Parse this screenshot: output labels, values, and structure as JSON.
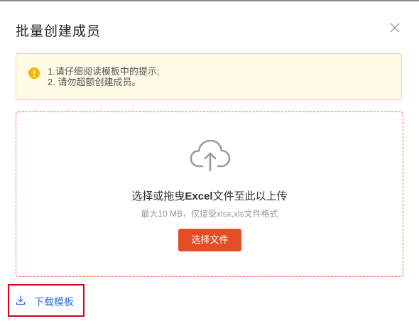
{
  "dialog": {
    "title": "批量创建成员"
  },
  "alert": {
    "icon": "warning-circle-icon",
    "lines": [
      "1.请仔细阅读模板中的提示;",
      "2. 请勿超额创建成员。"
    ]
  },
  "upload": {
    "icon": "cloud-upload-icon",
    "prompt_prefix": "选择或拖曳",
    "prompt_bold": "Excel",
    "prompt_suffix": "文件至此以上传",
    "hint": "最大10 MB，仅接受xlsx,xls文件格式",
    "button_label": "选择文件"
  },
  "download": {
    "icon": "download-icon",
    "label": "下载模板"
  },
  "colors": {
    "accent": "#e44d26",
    "link": "#2f6fd6",
    "warning": "#f5b800",
    "highlight_box": "#d9001b"
  }
}
